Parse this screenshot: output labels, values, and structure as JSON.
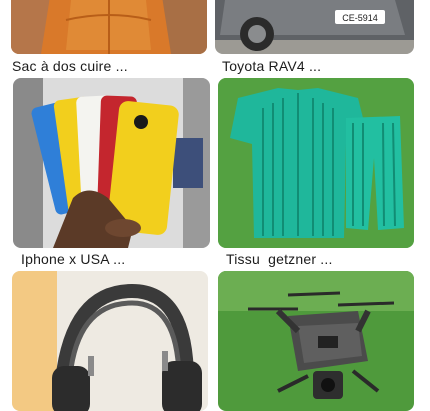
{
  "listings": [
    {
      "title": "Sac à dos cuire ...",
      "image_icon": "leather-backpack-photo"
    },
    {
      "title": "Toyota RAV4 ...",
      "image_icon": "toyota-rav4-photo",
      "plate_text": "CE-5914"
    },
    {
      "title": "Iphone x USA ...",
      "image_icon": "iphone-xr-colors-photo"
    },
    {
      "title": "Tissu  getzner ...",
      "image_icon": "green-getzner-outfit-photo"
    },
    {
      "title": "",
      "image_icon": "headphones-photo"
    },
    {
      "title": "",
      "image_icon": "drone-photo"
    }
  ],
  "colors": {
    "backpack": "#d9792a",
    "car": "#6b6e72",
    "iphone_yellow": "#f2cf1d",
    "outfit_green": "#1fb79b",
    "grass": "#4f9a3c"
  }
}
